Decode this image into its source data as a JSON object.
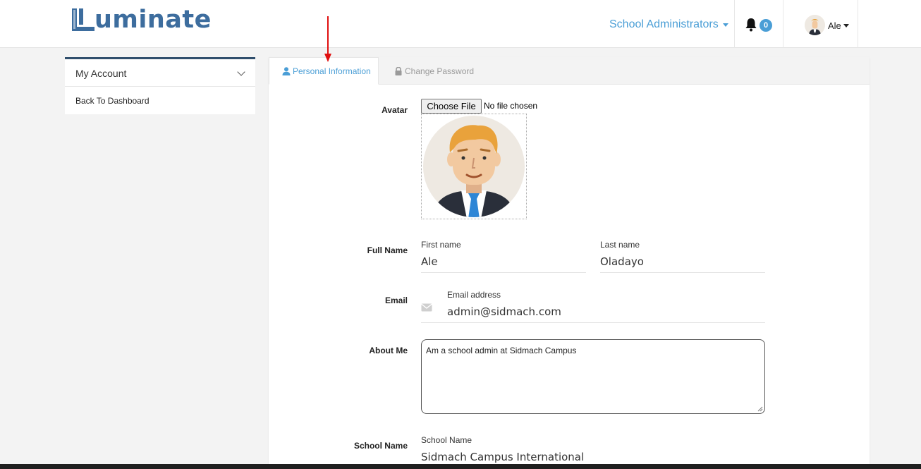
{
  "header": {
    "logo_text": "uminate",
    "admin_menu_label": "School Administrators",
    "notification_count": "0",
    "user_name": "Ale"
  },
  "sidebar": {
    "heading": "My Account",
    "items": [
      {
        "label": "Back To Dashboard"
      }
    ]
  },
  "tabs": [
    {
      "label": "Personal Information",
      "icon": "user-icon",
      "active": true
    },
    {
      "label": "Change Password",
      "icon": "lock-icon",
      "active": false
    }
  ],
  "form": {
    "avatar": {
      "label": "Avatar",
      "button_label": "Choose File",
      "file_status": "No file chosen"
    },
    "full_name": {
      "label": "Full Name",
      "first_label": "First name",
      "first_value": "Ale",
      "last_label": "Last name",
      "last_value": "Oladayo"
    },
    "email": {
      "label": "Email",
      "field_label": "Email address",
      "value": "admin@sidmach.com",
      "icon": "envelope-icon"
    },
    "about": {
      "label": "About Me",
      "value": "Am a school admin at Sidmach Campus"
    },
    "school": {
      "label": "School Name",
      "field_label": "School Name",
      "value": "Sidmach Campus International"
    }
  },
  "colors": {
    "accent": "#4a9ed6",
    "brand": "#3d6d9e",
    "sidebar_border": "#2f4e6c",
    "annotation_arrow": "#e01010"
  }
}
